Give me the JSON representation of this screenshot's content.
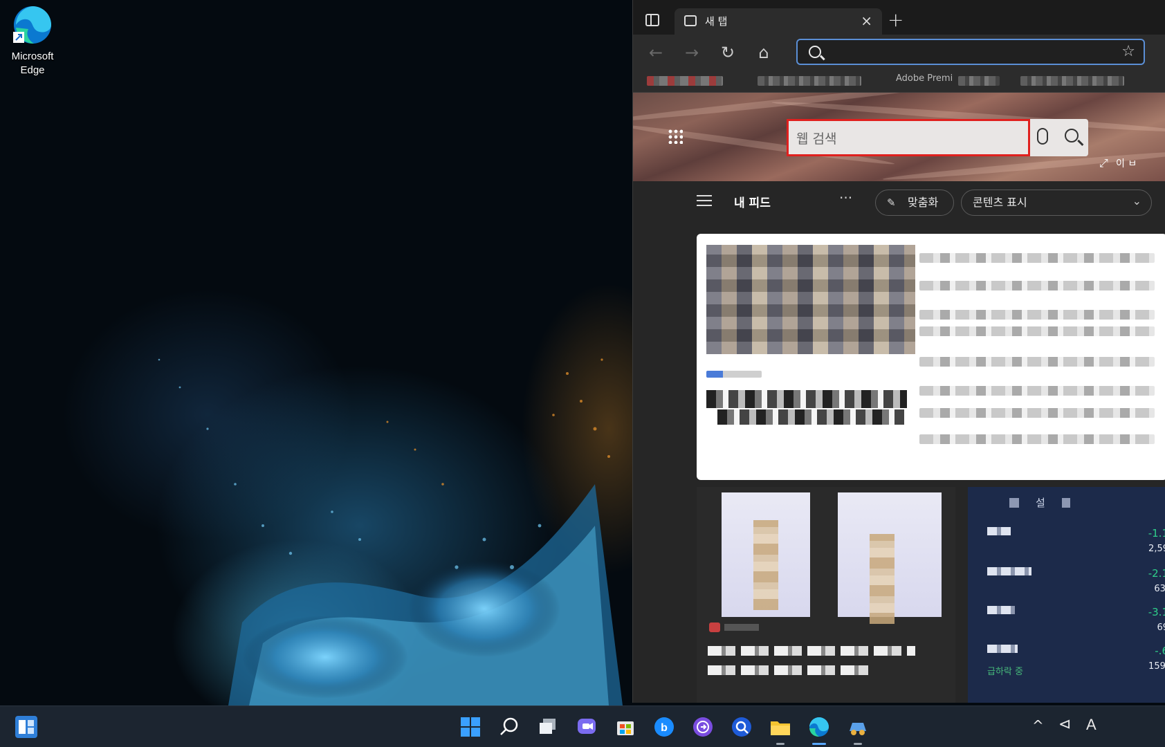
{
  "desktop": {
    "icons": [
      {
        "label": "Microsoft Edge",
        "icon": "edge-icon"
      }
    ]
  },
  "browser": {
    "tab": {
      "title": "새 탭",
      "icon": "new-tab-page-icon"
    },
    "toolbar": {
      "back": "←",
      "forward": "→",
      "refresh": "↻",
      "home": "⌂",
      "address_value": "",
      "favorite_icon": "star-plus-icon"
    },
    "bookmarks": [
      "Adobe Premi"
    ],
    "ntp": {
      "search_placeholder": "웹 검색",
      "expand_label": "이 ㅂ",
      "feed_title": "내 피드",
      "more": "···",
      "personalize_label": "맞춤화",
      "content_display_label": "콘텐츠 표시"
    },
    "market_card": {
      "header": "설",
      "rows": [
        {
          "change": "-1.1",
          "value": "2,59",
          "sub": ""
        },
        {
          "change": "-2.1",
          "value": "63,",
          "sub": ""
        },
        {
          "change": "-3.1",
          "value": "69",
          "sub": ""
        },
        {
          "change": "-.6",
          "value": "159,",
          "sub": "급하락 중"
        }
      ]
    }
  },
  "taskbar": {
    "items": [
      "widgets-icon",
      "start-icon",
      "search-icon",
      "task-view-icon",
      "chat-icon",
      "store-icon",
      "bing-icon",
      "app-icon",
      "search-app-icon",
      "file-explorer-icon",
      "edge-icon",
      "app-icon-2"
    ],
    "tray": {
      "chevron": "^",
      "language": "A"
    }
  },
  "colors": {
    "highlight": "#e0201e",
    "accent": "#5b8fd6",
    "taskbar": "#1c2530"
  }
}
